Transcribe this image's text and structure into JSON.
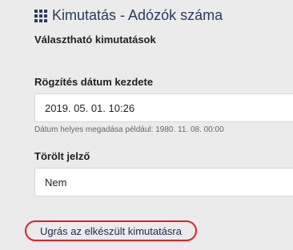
{
  "header": {
    "icon": "grid-icon",
    "title": "Kimutatás - Adózók száma"
  },
  "section": {
    "subtitle": "Választható kimutatások"
  },
  "fields": {
    "start_date": {
      "label": "Rögzítés dátum kezdete",
      "value": "2019. 05. 01. 10:26",
      "hint": "Dátum helyes megadása például: 1980. 11. 08. 00:00"
    },
    "deleted_flag": {
      "label": "Törölt jelző",
      "value": "Nem"
    }
  },
  "link": {
    "text": "Ugrás az elkészült kimutatásra",
    "highlight_color": "#d9242a"
  }
}
